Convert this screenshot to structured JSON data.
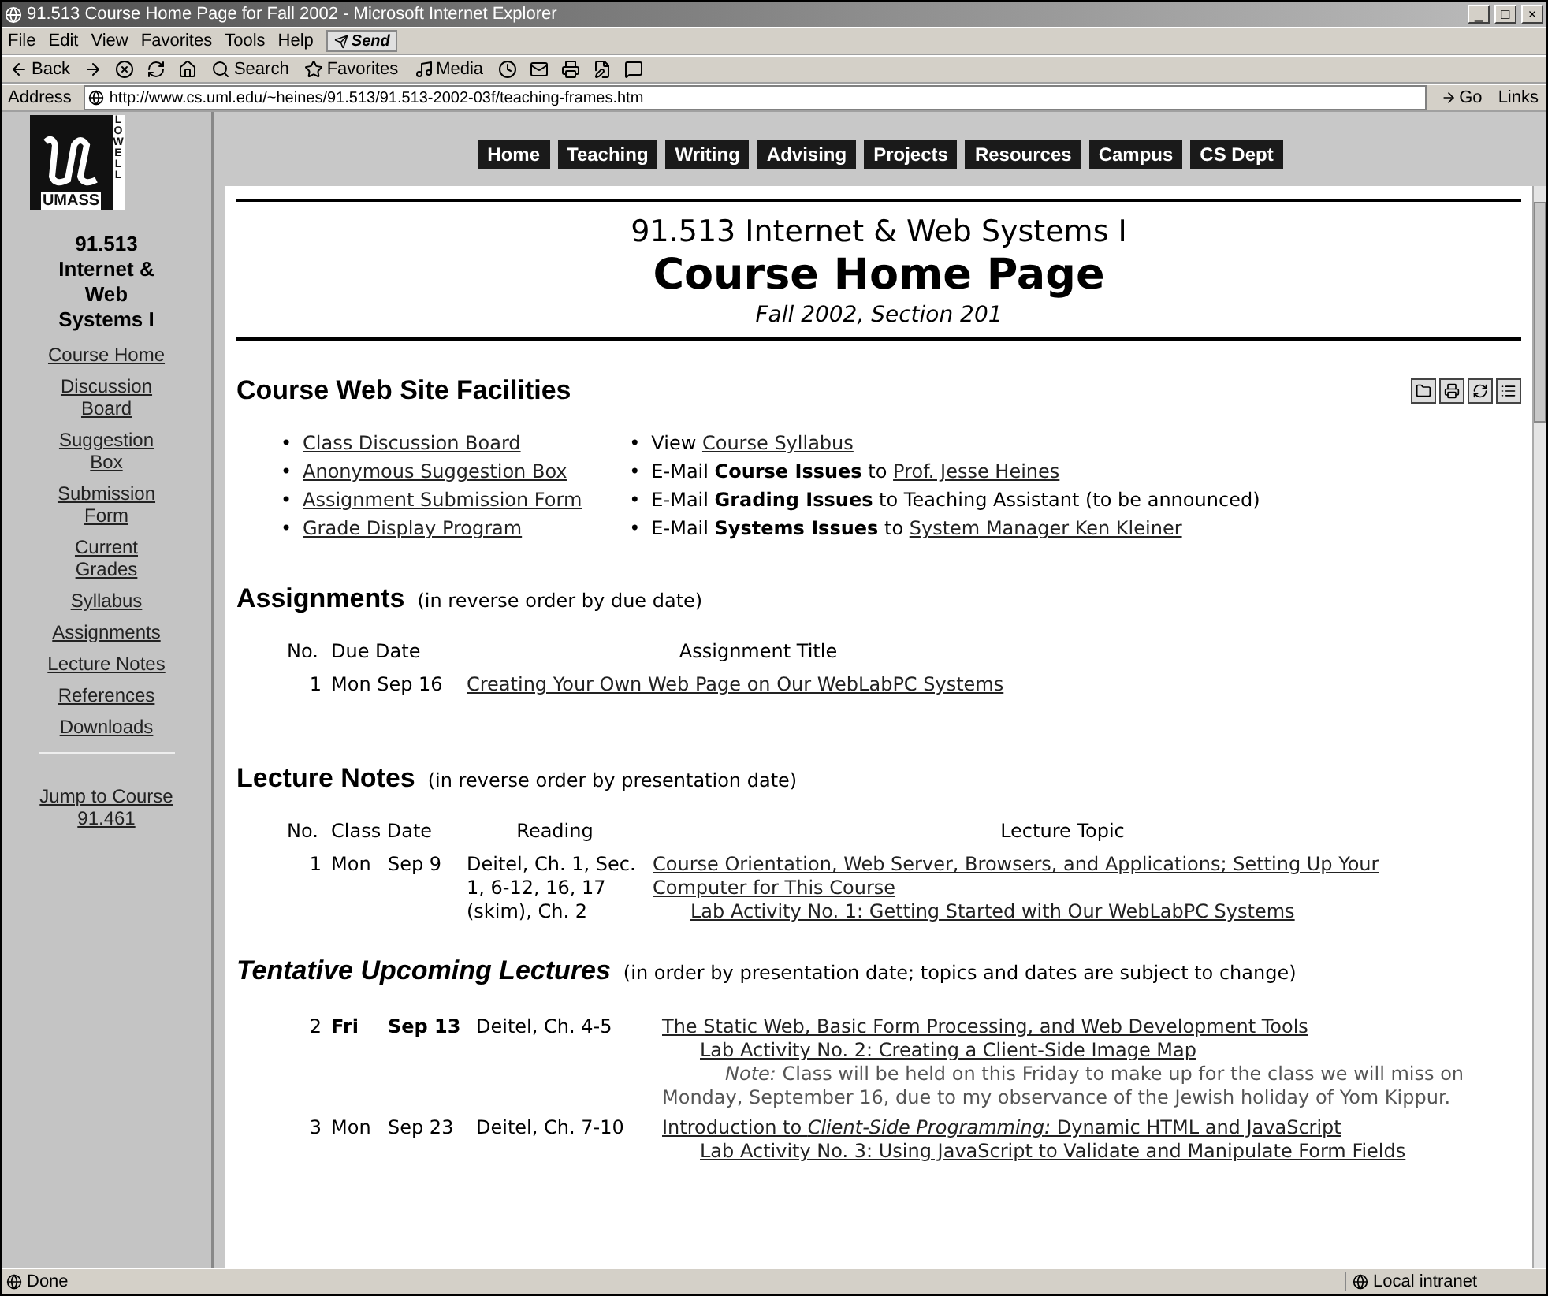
{
  "window": {
    "title": "91.513 Course Home Page for Fall 2002 - Microsoft Internet Explorer",
    "controls": [
      "_",
      "□",
      "×"
    ]
  },
  "menu": [
    "File",
    "Edit",
    "View",
    "Favorites",
    "Tools",
    "Help"
  ],
  "send_button": "Send",
  "toolbar": [
    {
      "kind": "back",
      "label": "Back"
    },
    {
      "kind": "forward"
    },
    {
      "kind": "stop"
    },
    {
      "kind": "refresh"
    },
    {
      "kind": "home"
    },
    {
      "kind": "search",
      "label": "Search"
    },
    {
      "kind": "favorites",
      "label": "Favorites"
    },
    {
      "kind": "media",
      "label": "Media"
    },
    {
      "kind": "history"
    },
    {
      "kind": "mail"
    },
    {
      "kind": "print"
    },
    {
      "kind": "edit"
    },
    {
      "kind": "discuss"
    }
  ],
  "address": {
    "label": "Address",
    "url": "http://www.cs.uml.edu/~heines/91.513/91.513-2002-03f/teaching-frames.htm",
    "go": "Go",
    "links": "Links"
  },
  "nav": [
    "Home",
    "Teaching",
    "Writing",
    "Advising",
    "Projects",
    "Resources",
    "Campus",
    "CS Dept"
  ],
  "sidebar": {
    "logo_text": "UMASS",
    "logo_side": "LOWELL",
    "course": "91.513 Internet & Web Systems I",
    "links": [
      "Course Home",
      "Discussion Board",
      "Suggestion Box",
      "Submission Form",
      "Current Grades",
      "Syllabus",
      "Assignments",
      "Lecture Notes",
      "References",
      "Downloads"
    ],
    "jump": "Jump to Course 91.461"
  },
  "header": {
    "course": "91.513 Internet & Web Systems I",
    "title": "Course Home Page",
    "term": "Fall 2002, Section 201"
  },
  "facilities": {
    "heading": "Course Web Site Facilities",
    "bullet": "•",
    "left": [
      "Class Discussion Board",
      "Anonymous Suggestion Box",
      "Assignment Submission Form",
      "Grade Display Program"
    ],
    "right": [
      {
        "text": "View",
        "link": "Course Syllabus"
      },
      {
        "text": "E-Mail **Course Issues** to",
        "link": "Prof. Jesse Heines"
      },
      {
        "text": "E-Mail **Grading Issues** to Teaching Assistant (to be announced)"
      },
      {
        "text": "E-Mail **Systems Issues** to",
        "link": "System Manager Ken Kleiner"
      }
    ]
  },
  "assignments": {
    "heading": "Assignments",
    "note": "(in reverse order by due date)",
    "columns": [
      "No.",
      "Due Date",
      "Assignment Title"
    ],
    "rows": [
      {
        "no": "1",
        "date": "Mon Sep 16",
        "title": "Creating Your Own Web Page on Our WebLabPC Systems"
      }
    ]
  },
  "lectures": {
    "heading": "Lecture Notes",
    "note": "(in reverse order by presentation date)",
    "columns": [
      "No.",
      "Class Date",
      "Reading",
      "Lecture Topic"
    ],
    "rows": [
      {
        "no": "1",
        "day": "Mon",
        "date": "Sep 9",
        "reading": "Deitel, Ch. 1, Sec. 1, 6-12, 16, 17 (skim), Ch. 2",
        "topic": "Course Orientation, Web Server, Browsers, and Applications; Setting Up Your Computer for This Course",
        "lab": "Lab Activity No. 1:  Getting Started with Our WebLabPC Systems"
      }
    ]
  },
  "upcoming": {
    "heading": "Tentative Upcoming Lectures",
    "note": "(in order by presentation date; topics and dates are subject to change)",
    "rows": [
      {
        "no": "2",
        "day": "Fri",
        "date": "Sep 13",
        "highlighted": true,
        "reading": "Deitel, Ch. 4-5",
        "topic": "The Static Web, Basic Form Processing, and Web Development Tools",
        "lab": "Lab Activity No. 2:  Creating a Client-Side Image Map",
        "note": "*Note:*  Class will be held on this Friday to make up for the class we will miss on Monday, September 16, due to my observance of the Jewish holiday of Yom Kippur."
      },
      {
        "no": "3",
        "day": "Mon",
        "date": "Sep 23",
        "highlighted": false,
        "reading": "Deitel, Ch. 7-10",
        "topic": "Introduction to *Client-Side Programming:*  Dynamic HTML and JavaScript",
        "lab": "Lab Activity No. 3:  Using JavaScript to Validate and Manipulate Form Fields"
      }
    ]
  },
  "status": {
    "text": "Done",
    "zone": "Local intranet"
  }
}
